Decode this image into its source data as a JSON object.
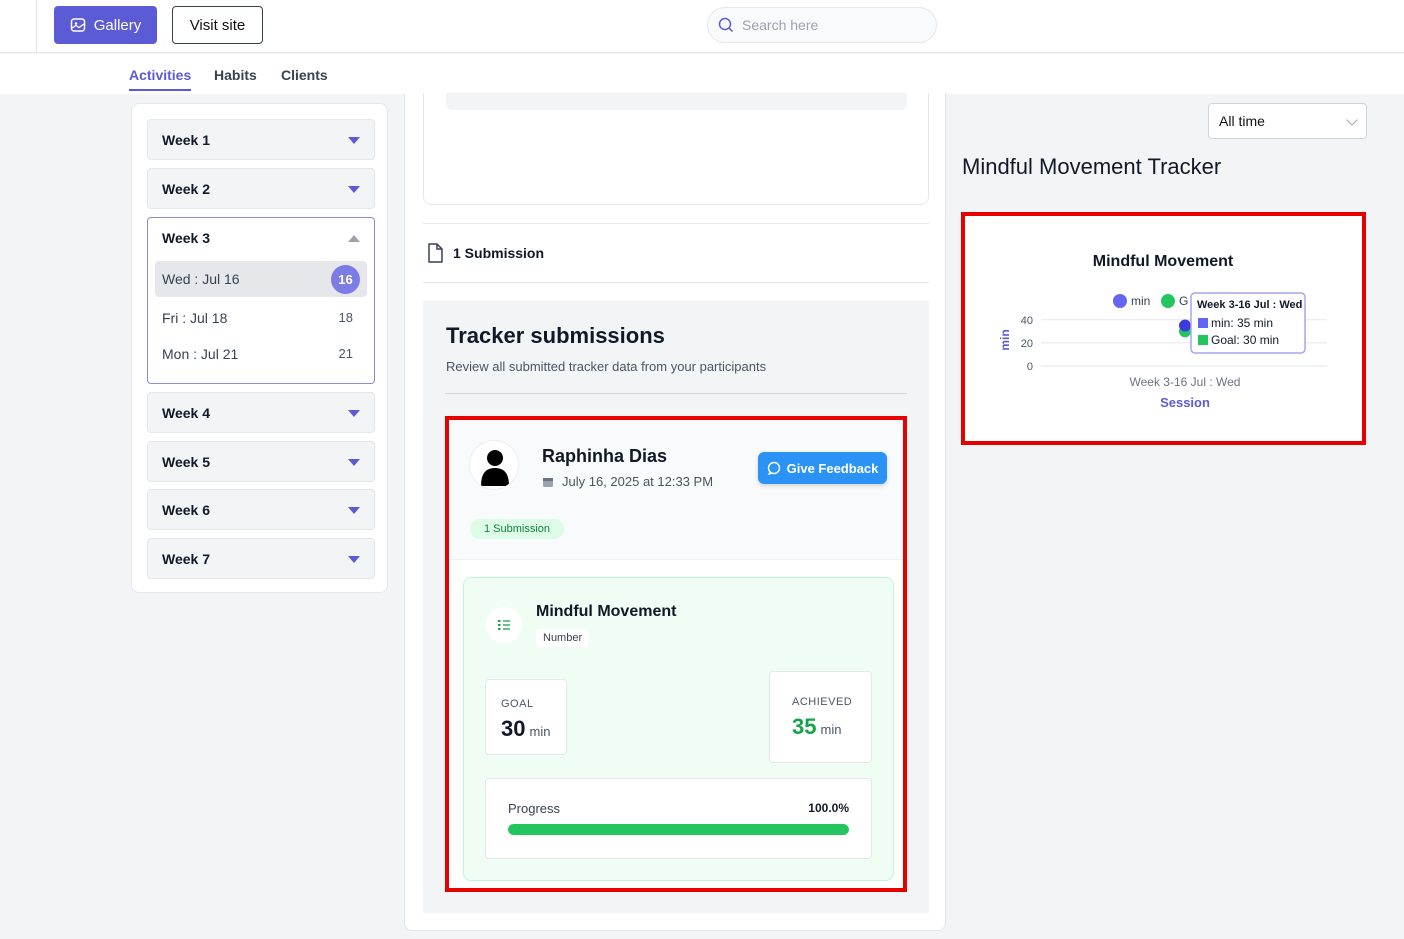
{
  "header": {
    "gallery_label": "Gallery",
    "visit_label": "Visit site",
    "search_placeholder": "Search here"
  },
  "tabs": [
    {
      "label": "Activities",
      "active": true
    },
    {
      "label": "Habits",
      "active": false
    },
    {
      "label": "Clients",
      "active": false
    }
  ],
  "weeks": {
    "w1": "Week 1",
    "w2": "Week 2",
    "w3": "Week 3",
    "w4": "Week 4",
    "w5": "Week 5",
    "w6": "Week 6",
    "w7": "Week 7",
    "w3_days": [
      {
        "label": "Wed : Jul 16",
        "num": "16",
        "selected": true
      },
      {
        "label": "Fri : Jul 18",
        "num": "18",
        "selected": false
      },
      {
        "label": "Mon : Jul 21",
        "num": "21",
        "selected": false
      }
    ]
  },
  "middle": {
    "submission_count": "1 Submission",
    "tracker_title": "Tracker submissions",
    "tracker_subtitle": "Review all submitted tracker data from your participants",
    "submission": {
      "user_name": "Raphinha Dias",
      "date": "July 16, 2025 at 12:33 PM",
      "feedback_label": "Give Feedback",
      "badge": "1 Submission",
      "metric": {
        "title": "Mindful Movement",
        "type": "Number",
        "goal_label": "GOAL",
        "goal_value": "30",
        "goal_unit": "min",
        "achieved_label": "ACHIEVED",
        "achieved_value": "35",
        "achieved_unit": "min",
        "progress_label": "Progress",
        "progress_value": "100.0%",
        "progress_fraction": 1.0
      }
    }
  },
  "right": {
    "range_select": "All time",
    "tracker_title": "Mindful Movement Tracker"
  },
  "colors": {
    "accent": "#5b5bd6",
    "min_series": "#6366f1",
    "goal_series": "#22c55e",
    "highlight_border": "#e60000"
  },
  "chart_data": {
    "type": "scatter",
    "title": "Mindful Movement",
    "xlabel": "Session",
    "ylabel": "min",
    "categories": [
      "Week 3-16 Jul : Wed"
    ],
    "y_ticks": [
      "0",
      "20",
      "40"
    ],
    "ylim": [
      0,
      45
    ],
    "series": [
      {
        "name": "min",
        "values": [
          35
        ]
      },
      {
        "name": "Goal",
        "values": [
          30
        ]
      }
    ],
    "legend_visible": [
      "min",
      "G"
    ],
    "legend_position": "top",
    "tooltip": {
      "title": "Week 3-16 Jul : Wed",
      "lines": [
        "min: 35 min",
        "Goal: 30 min"
      ]
    }
  }
}
